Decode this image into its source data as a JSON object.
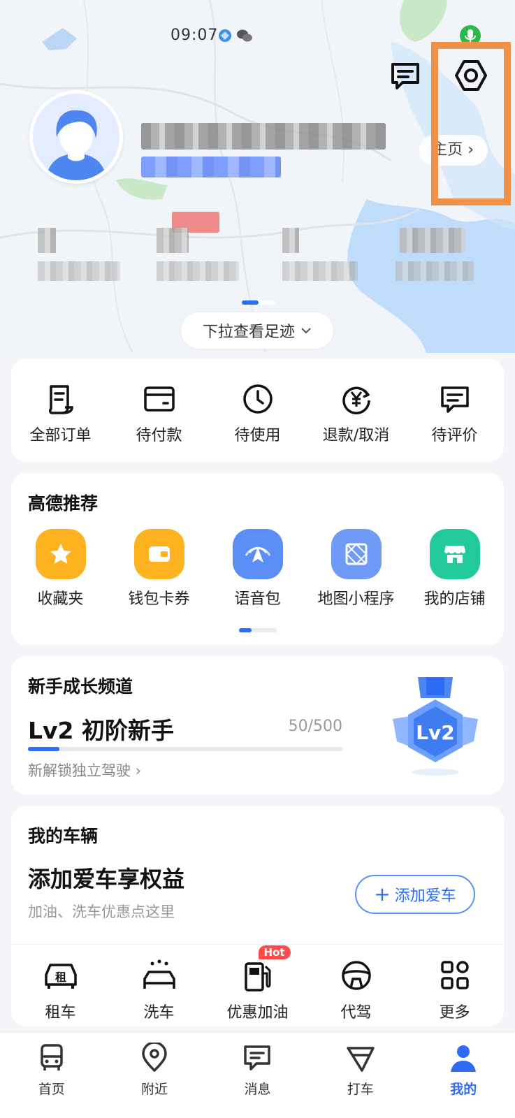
{
  "status_bar": {
    "time": "09:07"
  },
  "profile": {
    "homepage_label": "主页"
  },
  "footprint": {
    "label": "下拉查看足迹"
  },
  "orders": {
    "items": [
      {
        "label": "全部订单",
        "icon": "order-list-icon"
      },
      {
        "label": "待付款",
        "icon": "wallet-icon"
      },
      {
        "label": "待使用",
        "icon": "clock-icon"
      },
      {
        "label": "退款/取消",
        "icon": "refund-icon"
      },
      {
        "label": "待评价",
        "icon": "comment-icon"
      }
    ]
  },
  "recommend": {
    "title": "高德推荐",
    "items": [
      {
        "label": "收藏夹",
        "icon": "star-icon",
        "color": "#ffb21f"
      },
      {
        "label": "钱包卡券",
        "icon": "wallet-card-icon",
        "color": "#ffb21f"
      },
      {
        "label": "语音包",
        "icon": "voice-pack-icon",
        "color": "#5b8ef7"
      },
      {
        "label": "地图小程序",
        "icon": "map-miniapp-icon",
        "color": "#6f9af8"
      },
      {
        "label": "我的店铺",
        "icon": "shop-icon",
        "color": "#22c99a"
      }
    ]
  },
  "growth": {
    "title": "新手成长频道",
    "level_title": "Lv2 初阶新手",
    "progress_text": "50/500",
    "progress_fraction": 0.1,
    "hint": "新解锁独立驾驶",
    "badge_text": "Lv2"
  },
  "vehicle": {
    "title": "我的车辆",
    "headline": "添加爱车享权益",
    "subtitle": "加油、洗车优惠点这里",
    "add_button": "添加爱车",
    "services": [
      {
        "label": "租车",
        "icon": "rent-car-icon",
        "glyph": "租"
      },
      {
        "label": "洗车",
        "icon": "car-wash-icon"
      },
      {
        "label": "优惠加油",
        "icon": "fuel-icon",
        "badge": "Hot"
      },
      {
        "label": "代驾",
        "icon": "steering-wheel-icon"
      },
      {
        "label": "更多",
        "icon": "grid-more-icon"
      }
    ]
  },
  "tabbar": {
    "active": "我的",
    "items": [
      {
        "label": "首页",
        "icon": "home-bus-icon"
      },
      {
        "label": "附近",
        "icon": "location-pin-icon"
      },
      {
        "label": "消息",
        "icon": "message-icon"
      },
      {
        "label": "打车",
        "icon": "taxi-flag-icon"
      },
      {
        "label": "我的",
        "icon": "profile-icon"
      }
    ]
  },
  "colors": {
    "accent": "#2e6cf6",
    "highlight": "#f0914a",
    "hot": "#ff4b4b"
  }
}
